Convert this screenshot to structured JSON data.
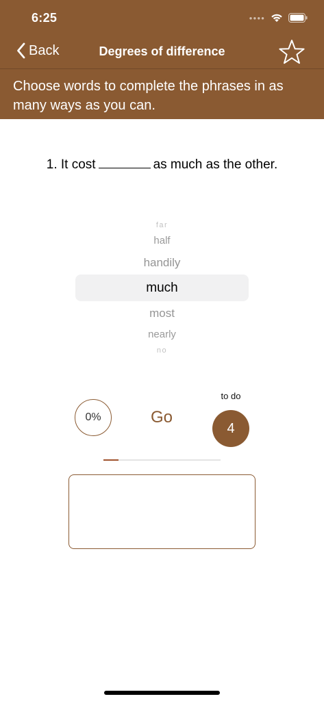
{
  "status_bar": {
    "time": "6:25",
    "signal_icon": "signal-dots-icon",
    "wifi_icon": "wifi-icon",
    "battery_icon": "battery-icon"
  },
  "nav": {
    "back_label": "Back",
    "back_icon": "chevron-left-icon",
    "title": "Degrees of difference",
    "favorite_icon": "star-outline-icon"
  },
  "instructions": "Choose words to complete the phrases in as many ways as you can.",
  "question": {
    "before": "1. It cost",
    "after": "as much as the other."
  },
  "picker": {
    "items": [
      "far",
      "half",
      "handily",
      "much",
      "most",
      "nearly",
      "no"
    ],
    "selected": "much"
  },
  "controls": {
    "percent": "0%",
    "go_label": "Go",
    "todo_label": "to do",
    "todo_count": "4",
    "progress": 0.13
  },
  "answer": {
    "value": ""
  },
  "colors": {
    "brand": "#8a5a32",
    "progress": "#a0522d",
    "picker_inactive": "#a0a0a0"
  }
}
